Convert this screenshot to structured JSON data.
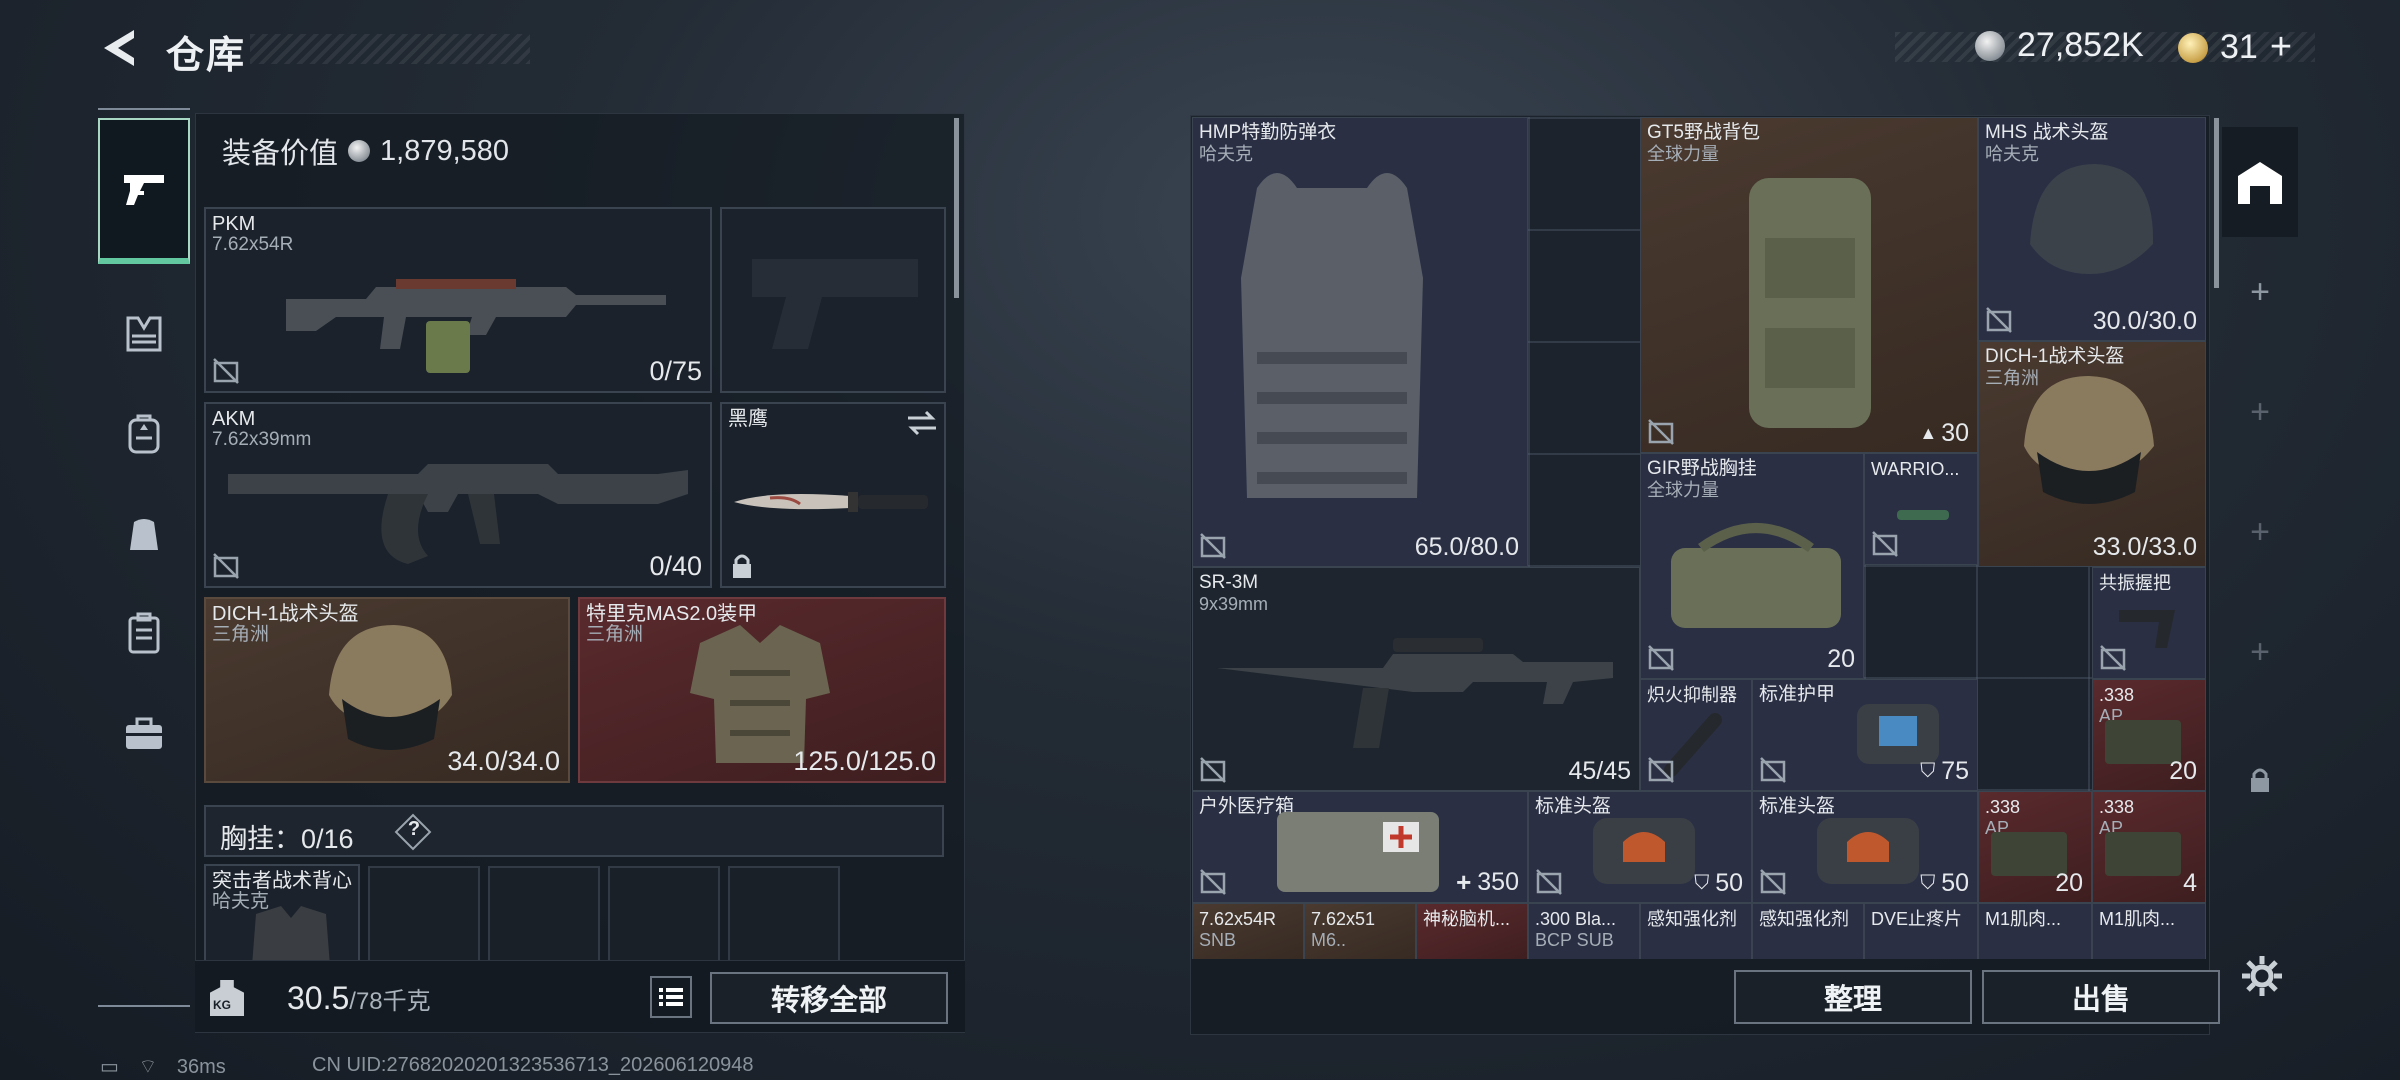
{
  "header": {
    "title": "仓库",
    "currency_main": "27,852K",
    "currency_premium": "31",
    "premium_plus": "+"
  },
  "left_rail": [
    "pistol-icon",
    "armor-icon",
    "backpack-icon",
    "chest-rig-icon",
    "locker-icon",
    "medkit-case-icon"
  ],
  "loadout": {
    "equip_value_label": "装备价值",
    "equip_value": "1,879,580",
    "primary": {
      "name": "PKM",
      "caliber": "7.62x54R",
      "ammo": "0/75"
    },
    "secondary": {
      "name": "AKM",
      "caliber": "7.62x39mm",
      "ammo": "0/40"
    },
    "melee": {
      "name": "黑鹰"
    },
    "helmet": {
      "name": "DICH-1战术头盔",
      "faction": "三角洲",
      "durability": "34.0/34.0"
    },
    "armor": {
      "name": "特里克MAS2.0装甲",
      "faction": "三角洲",
      "durability": "125.0/125.0"
    },
    "chest_rig_label": "胸挂",
    "chest_rig_capacity": "0/16",
    "chest_help": "?",
    "chest_item": {
      "name": "突击者战术背心",
      "faction": "哈夫克"
    }
  },
  "weight": {
    "current": "30.5",
    "max": "/78千克",
    "kg": "KG"
  },
  "buttons": {
    "transfer_all": "转移全部",
    "sort": "整理",
    "sell": "出售"
  },
  "stash": {
    "hmp": {
      "name": "HMP特勤防弹衣",
      "faction": "哈夫克",
      "durability": "65.0/80.0"
    },
    "gt5": {
      "name": "GT5野战背包",
      "faction": "全球力量",
      "capacity": "30"
    },
    "mhs": {
      "name": "MHS 战术头盔",
      "faction": "哈夫克",
      "durability": "30.0/30.0"
    },
    "dich": {
      "name": "DICH-1战术头盔",
      "faction": "三角洲",
      "durability": "33.0/33.0"
    },
    "gir": {
      "name": "GIR野战胸挂",
      "faction": "全球力量",
      "capacity": "20"
    },
    "warrior": {
      "name": "WARRIO..."
    },
    "sr3m": {
      "name": "SR-3M",
      "caliber": "9x39mm",
      "ammo": "45/45"
    },
    "grip": {
      "name": "共振握把"
    },
    "ammo338a": {
      "name": ".338",
      "sub": "AP",
      "count": "20"
    },
    "suppressor": {
      "name": "炽火抑制器"
    },
    "armor_kit": {
      "name": "标准护甲",
      "value": "75"
    },
    "medbox": {
      "name": "户外医疗箱",
      "value": "350"
    },
    "helm_kit1": {
      "name": "标准头盔",
      "value": "50"
    },
    "helm_kit2": {
      "name": "标准头盔",
      "value": "50"
    },
    "ammo338b": {
      "name": ".338",
      "sub": "AP",
      "count": "20"
    },
    "ammo338c": {
      "name": ".338",
      "sub": "AP",
      "count": "4"
    },
    "bottom_row": [
      "7.62x54R",
      "7.62x51",
      "神秘脑机...",
      ".300 Bla...",
      "感知强化剂",
      "感知强化剂",
      "DVE止疼片",
      "M1肌肉...",
      "M1肌肉..."
    ],
    "bottom_sub": [
      "SNB",
      "M6..",
      "",
      "BCP SUB",
      "",
      "",
      "",
      "",
      ""
    ]
  },
  "right_rail": [
    "stash-icon",
    "plus-icon",
    "plus-icon",
    "plus-icon",
    "plus-icon",
    "lock-icon"
  ],
  "status": {
    "ping": "36ms",
    "uid": "CN UID:27682020201323536713_202606120948"
  },
  "colors": {
    "accent_green": "#63c7a0",
    "slot_brown": "#4a3a30",
    "slot_red": "#5a2a2d",
    "slot_blue": "#2a2f44"
  }
}
